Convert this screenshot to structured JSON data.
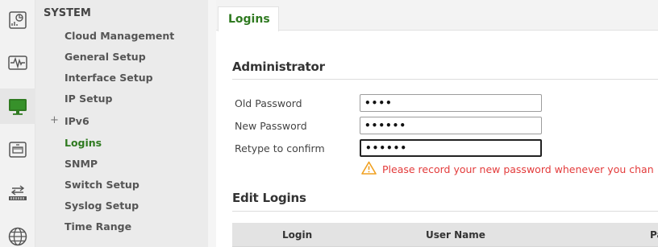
{
  "rail": {
    "icons": [
      "dashboard-icon",
      "monitor-wave-icon",
      "configuration-screen-icon",
      "network-device-icon",
      "switch-ports-icon",
      "globe-icon"
    ]
  },
  "menu": {
    "title": "SYSTEM",
    "items": [
      {
        "label": "Cloud Management",
        "active": false
      },
      {
        "label": "General Setup",
        "active": false
      },
      {
        "label": "Interface Setup",
        "active": false
      },
      {
        "label": "IP Setup",
        "active": false
      },
      {
        "label": "IPv6",
        "active": false,
        "expand": "+"
      },
      {
        "label": "Logins",
        "active": true
      },
      {
        "label": "SNMP",
        "active": false
      },
      {
        "label": "Switch Setup",
        "active": false
      },
      {
        "label": "Syslog Setup",
        "active": false
      },
      {
        "label": "Time Range",
        "active": false
      }
    ]
  },
  "tabs": [
    {
      "label": "Logins",
      "active": true
    }
  ],
  "administrator": {
    "title": "Administrator",
    "fields": [
      {
        "label": "Old Password",
        "value": "••••"
      },
      {
        "label": "New Password",
        "value": "••••••"
      },
      {
        "label": "Retype to confirm",
        "value": "••••••"
      }
    ],
    "warning": "Please record your new password whenever you chan"
  },
  "edit_logins": {
    "title": "Edit Logins",
    "columns": [
      "Login",
      "User Name",
      "Pa"
    ]
  },
  "colors": {
    "accent_green": "#2f7a20",
    "warning_red": "#e33b3b",
    "warning_orange": "#f0a020"
  }
}
